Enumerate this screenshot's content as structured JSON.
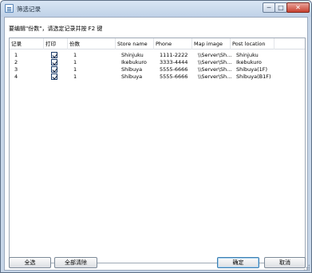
{
  "window": {
    "title": "筛选记录",
    "min_symbol": "─",
    "max_symbol": "□",
    "close_symbol": "✕"
  },
  "instruction": "要编辑\"份数\"，请选定记录并按 F2 键",
  "table": {
    "headers": [
      "记录",
      "打印",
      "份数",
      "Store name",
      "Phone",
      "Map image",
      "Post location"
    ],
    "rows": [
      {
        "record": "1",
        "print": true,
        "copies": "1",
        "store": "Shinjuku",
        "phone": "1111-2222",
        "map": "\\\\Server\\Sh...",
        "location": "Shinjuku"
      },
      {
        "record": "2",
        "print": true,
        "copies": "1",
        "store": "Ikebukuro",
        "phone": "3333-4444",
        "map": "\\\\Server\\Sh...",
        "location": "Ikebukuro"
      },
      {
        "record": "3",
        "print": true,
        "copies": "1",
        "store": "Shibuya",
        "phone": "5555-6666",
        "map": "\\\\Server\\Sh...",
        "location": "Shibuya(1F)"
      },
      {
        "record": "4",
        "print": true,
        "copies": "1",
        "store": "Shibuya",
        "phone": "5555-6666",
        "map": "\\\\Server\\Sh...",
        "location": "Shibuya(B1F)"
      }
    ]
  },
  "buttons": {
    "select_all": "全选",
    "clear_all": "全部清除",
    "ok": "确定",
    "cancel": "取消"
  }
}
